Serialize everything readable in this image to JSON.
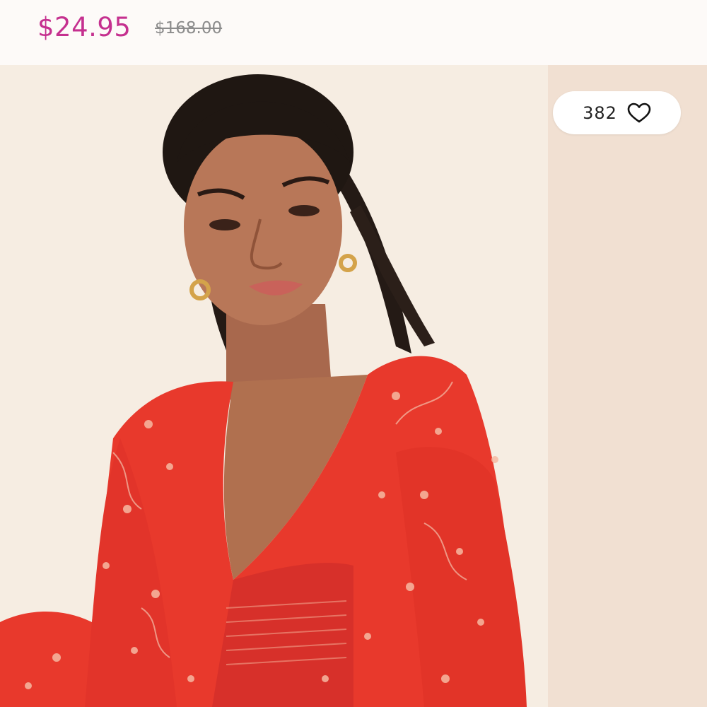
{
  "product": {
    "sale_price": "$24.95",
    "original_price": "$168.00",
    "likes": "382"
  },
  "icons": {
    "like": "heart-outline-icon"
  },
  "colors": {
    "sale_price": "#c5308f",
    "original_price": "#8c8c8c",
    "dress": "#e8392c"
  }
}
